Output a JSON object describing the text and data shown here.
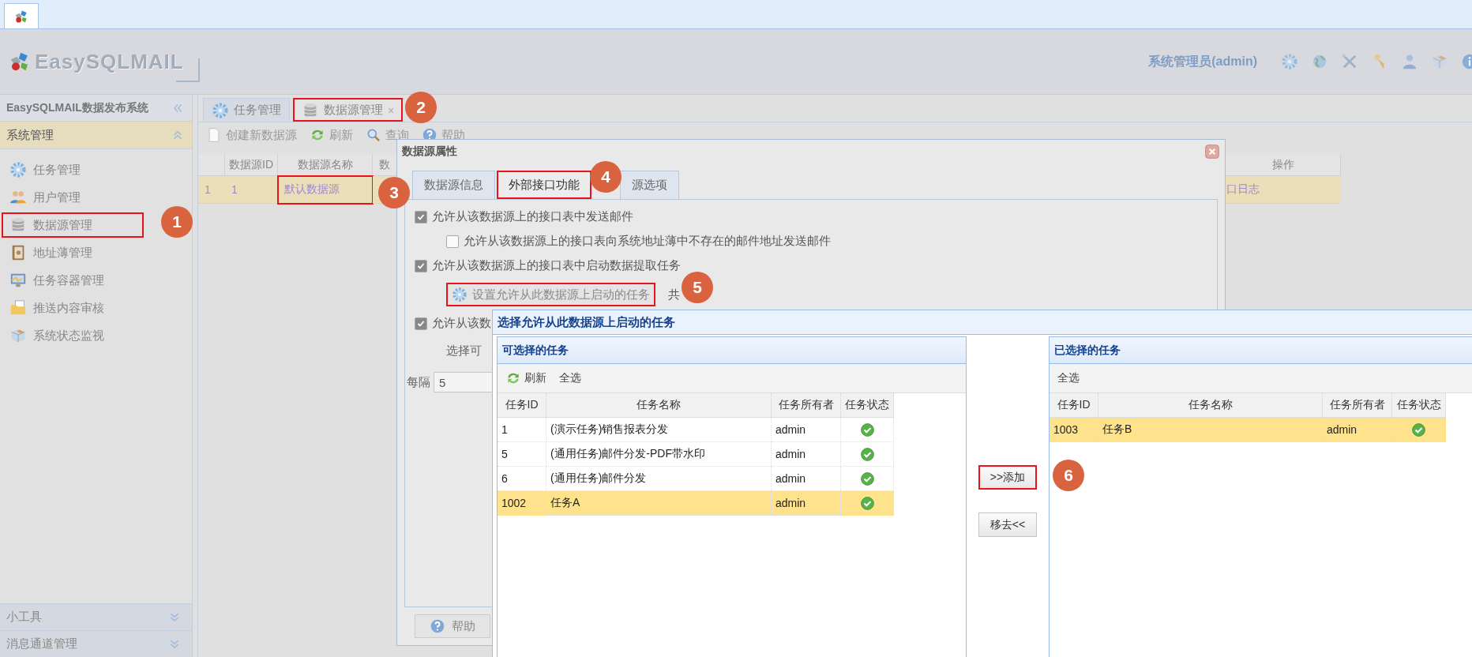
{
  "header": {
    "logo_text": "EasySQLMAIL",
    "user": "系统管理员(admin)"
  },
  "sidebar": {
    "title": "EasySQLMAIL数据发布系统",
    "section": "系统管理",
    "items": [
      {
        "label": "任务管理",
        "highlighted": false
      },
      {
        "label": "用户管理",
        "highlighted": false
      },
      {
        "label": "数据源管理",
        "highlighted": true
      },
      {
        "label": "地址薄管理",
        "highlighted": false
      },
      {
        "label": "任务容器管理",
        "highlighted": false
      },
      {
        "label": "推送内容审核",
        "highlighted": false
      },
      {
        "label": "系统状态监视",
        "highlighted": false
      }
    ],
    "bottom_sections": [
      "小工具",
      "消息通道管理"
    ]
  },
  "tabs": [
    {
      "label": "任务管理",
      "selected": false,
      "highlighted": false
    },
    {
      "label": "数据源管理",
      "selected": true,
      "highlighted": true,
      "close": "×"
    }
  ],
  "toolbar": [
    "创建新数据源",
    "刷新",
    "查询",
    "帮助"
  ],
  "grid": {
    "columns": [
      "数据源ID",
      "数据源名称",
      "数",
      "操作"
    ],
    "rows": [
      {
        "row_number": "1",
        "id": "1",
        "name": "默认数据源",
        "column_5": "口日志",
        "selected": true,
        "name_highlighted": true
      }
    ]
  },
  "properties_dialog": {
    "title": "数据源属性",
    "tabs": [
      {
        "label": "数据源信息",
        "selected": false,
        "highlighted": false
      },
      {
        "label": "外部接口功能",
        "selected": true,
        "highlighted": true
      },
      {
        "label": "源选项",
        "selected": false,
        "highlighted": false
      }
    ],
    "options": [
      {
        "kind": "checkbox",
        "label": "允许从该数据源上的接口表中发送邮件",
        "checked": true,
        "children": [
          {
            "kind": "checkbox",
            "label": "允许从该数据源上的接口表向系统地址薄中不存在的邮件地址发送邮件",
            "checked": false
          }
        ]
      },
      {
        "kind": "checkbox",
        "label": "允许从该数据源上的接口表中启动数据提取任务",
        "checked": true,
        "children": [
          {
            "kind": "button",
            "label": "设置允许从此数据源上启动的任务",
            "highlighted": true,
            "note": "共"
          }
        ]
      },
      {
        "kind": "checkbox",
        "label": "允许从该数",
        "checked": true,
        "children": [
          {
            "kind": "text",
            "label": "选择可"
          }
        ]
      }
    ],
    "interval": {
      "label": "每隔",
      "value": "5"
    },
    "help_button": "帮助"
  },
  "select_dialog": {
    "title": "选择允许从此数据源上启动的任务",
    "available": {
      "title": "可选择的任务",
      "actions": [
        {
          "label": "刷新",
          "kind": "refresh"
        },
        {
          "label": "全选",
          "kind": "plain"
        }
      ],
      "columns": [
        "任务ID",
        "任务名称",
        "任务所有者",
        "任务状态"
      ],
      "rows": [
        {
          "id": "1",
          "name": "(演示任务)销售报表分发",
          "owner": "admin",
          "enabled": true,
          "selected": false
        },
        {
          "id": "5",
          "name": "(通用任务)邮件分发-PDF带水印",
          "owner": "admin",
          "enabled": true,
          "selected": false
        },
        {
          "id": "6",
          "name": "(通用任务)邮件分发",
          "owner": "admin",
          "enabled": true,
          "selected": false
        },
        {
          "id": "1002",
          "name": "任务A",
          "owner": "admin",
          "enabled": true,
          "selected": true
        }
      ]
    },
    "buttons": [
      {
        "label": ">>添加",
        "highlighted": true
      },
      {
        "label": "移去<<",
        "highlighted": false
      }
    ],
    "chosen": {
      "title": "已选择的任务",
      "actions": [
        {
          "label": "全选",
          "kind": "plain"
        }
      ],
      "columns": [
        "任务ID",
        "任务名称",
        "任务所有者",
        "任务状态"
      ],
      "rows": [
        {
          "id": "1003",
          "name": "任务B",
          "owner": "admin",
          "enabled": true,
          "selected": true
        }
      ]
    }
  },
  "annotations": [
    {
      "number": "1"
    },
    {
      "number": "2"
    },
    {
      "number": "3"
    },
    {
      "number": "4"
    },
    {
      "number": "5"
    },
    {
      "number": "6"
    }
  ]
}
